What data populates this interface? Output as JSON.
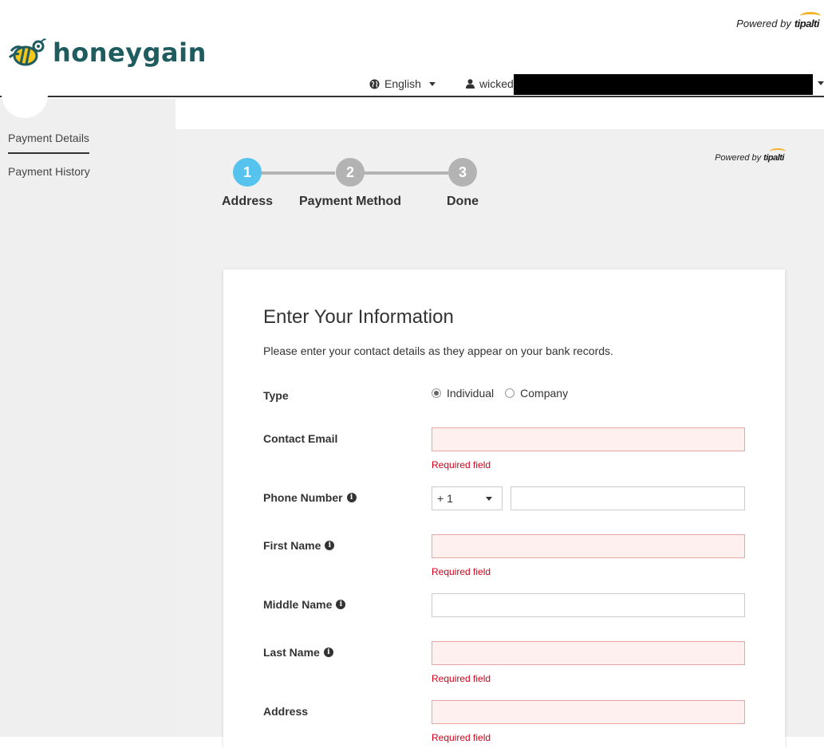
{
  "header": {
    "powered_by": "Powered by",
    "tipalti": "tipalti",
    "logo_text": "honeygain",
    "language": "English",
    "username": "wicked"
  },
  "sidebar": {
    "items": [
      {
        "label": "Payment Details",
        "active": true
      },
      {
        "label": "Payment History",
        "active": false
      }
    ]
  },
  "main": {
    "powered_by": "Powered by",
    "tipalti": "tipalti"
  },
  "stepper": {
    "steps": [
      {
        "number": "1",
        "label": "Address",
        "active": true
      },
      {
        "number": "2",
        "label": "Payment Method",
        "active": false
      },
      {
        "number": "3",
        "label": "Done",
        "active": false
      }
    ]
  },
  "form": {
    "title": "Enter Your Information",
    "subtitle": "Please enter your contact details as they appear on your bank records.",
    "type_label": "Type",
    "type_options": [
      "Individual",
      "Company"
    ],
    "type_selected": "Individual",
    "contact_email_label": "Contact Email",
    "phone_label": "Phone Number",
    "phone_code": "+ 1",
    "first_name_label": "First Name",
    "middle_name_label": "Middle Name",
    "last_name_label": "Last Name",
    "address_label": "Address",
    "required_text": "Required field"
  },
  "colors": {
    "brand": "#1e5c5f",
    "step_active": "#56c3ee",
    "step_inactive": "#b3b3b3",
    "error_text": "#d0021b",
    "error_bg": "#fff0f0"
  }
}
